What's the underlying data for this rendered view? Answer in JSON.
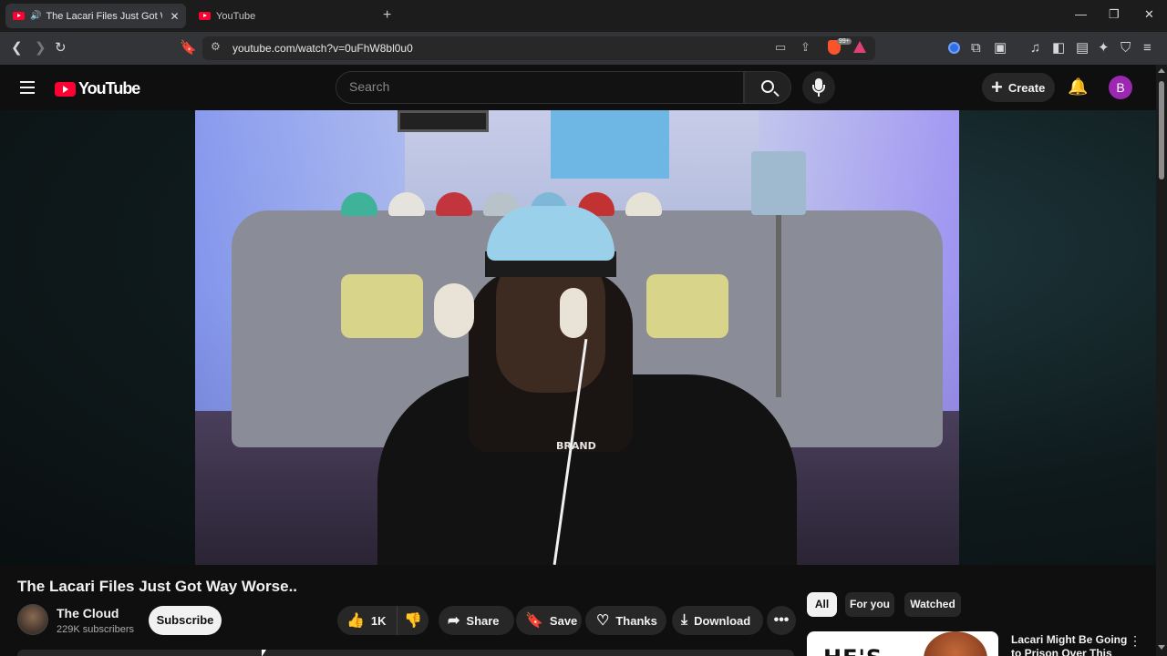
{
  "browser": {
    "tabs": [
      {
        "title": "The Lacari Files Just Got Way Worse..",
        "active": true,
        "audio": true
      },
      {
        "title": "YouTube",
        "active": false
      }
    ],
    "url": "youtube.com/watch?v=0uFhW8bl0u0",
    "shield_badge": "99+"
  },
  "header": {
    "logo_text": "YouTube",
    "search_placeholder": "Search",
    "create_label": "Create",
    "avatar_letter": "B"
  },
  "video": {
    "title": "The Lacari Files Just Got Way Worse..",
    "shirt_text": "BRAND",
    "channel": {
      "name": "The Cloud",
      "subscribers": "229K subscribers"
    },
    "subscribe_label": "Subscribe",
    "likes": "1K",
    "actions": {
      "share": "Share",
      "save": "Save",
      "thanks": "Thanks",
      "download": "Download"
    }
  },
  "sidebar": {
    "chips": [
      "All",
      "For you",
      "Watched"
    ],
    "recommendation": {
      "title": "Lacari Might Be Going to Prison Over This",
      "thumb_text": "HE'S"
    }
  },
  "colors": {
    "accent_red": "#ff0033",
    "avatar_purple": "#9c27b0",
    "background": "#0f0f0f"
  }
}
